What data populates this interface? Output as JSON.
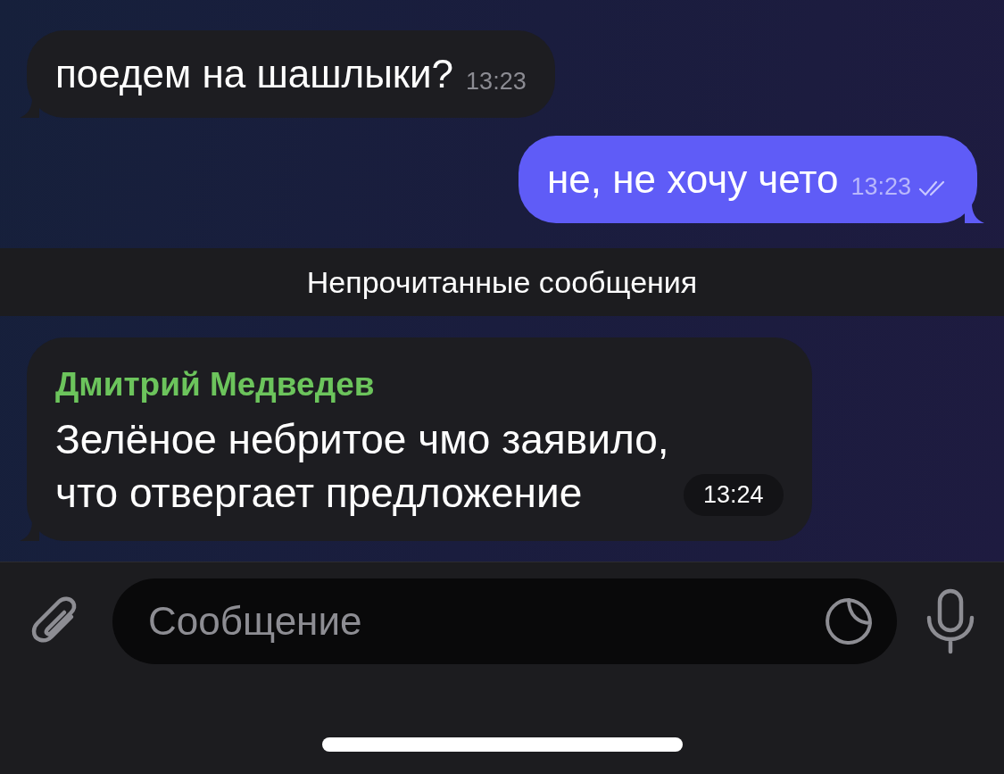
{
  "messages": [
    {
      "kind": "incoming",
      "text": "поедем на шашлыки?",
      "time": "13:23"
    },
    {
      "kind": "outgoing",
      "text": "не, не хочу чето",
      "time": "13:23",
      "read": true
    },
    {
      "kind": "divider",
      "text": "Непрочитанные сообщения"
    },
    {
      "kind": "incoming",
      "sender": "Дмитрий Медведев",
      "text": "Зелёное небритое чмо заявило, что отвергает предложение",
      "time": "13:24"
    }
  ],
  "composer": {
    "placeholder": "Сообщение"
  }
}
